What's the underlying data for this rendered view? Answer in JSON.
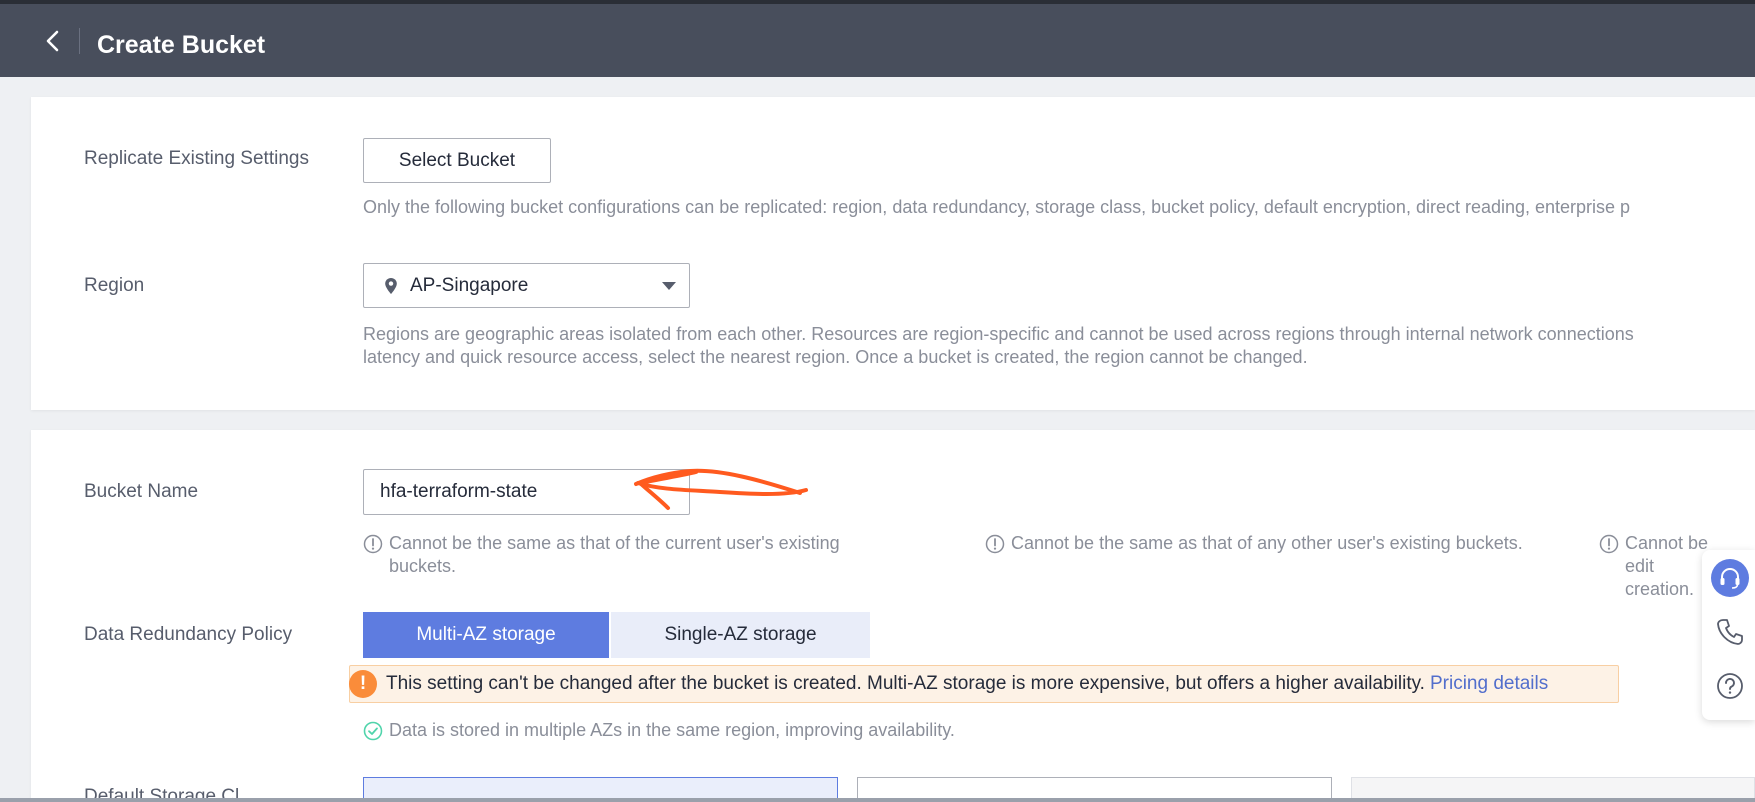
{
  "header": {
    "title": "Create Bucket",
    "back_icon": "chevron-left-icon"
  },
  "replicate": {
    "label": "Replicate Existing Settings",
    "button_label": "Select Bucket",
    "hint": "Only the following bucket configurations can be replicated: region, data redundancy, storage class, bucket policy, default encryption, direct reading, enterprise p"
  },
  "region": {
    "label": "Region",
    "value": "AP-Singapore",
    "icon": "location-pin-icon",
    "hint_line1": "Regions are geographic areas isolated from each other. Resources are region-specific and cannot be used across regions through internal network connections",
    "hint_line2": "latency and quick resource access, select the nearest region. Once a bucket is created, the region cannot be changed."
  },
  "bucket_name": {
    "label": "Bucket Name",
    "value": "hfa-terraform-state",
    "rules": [
      "Cannot be the same as that of the current user's existing buckets.",
      "Cannot be the same as that of any other user's existing buckets.",
      "Cannot be edit creation."
    ]
  },
  "redundancy": {
    "label": "Data Redundancy Policy",
    "options": [
      "Multi-AZ storage",
      "Single-AZ storage"
    ],
    "selected": "Multi-AZ storage",
    "warning": "This setting can't be changed after the bucket is created. Multi-AZ storage is more expensive, but offers a higher availability.",
    "warning_link": "Pricing details",
    "info": "Data is stored in multiple AZs in the same region, improving availability."
  },
  "storage_class": {
    "label": "Default Storage Cl"
  },
  "side_panel": {
    "items": [
      "headset-icon",
      "phone-icon",
      "help-icon"
    ]
  },
  "colors": {
    "header_bg": "#484e5c",
    "accent": "#5e7ce0",
    "warning": "#fa8c3a",
    "success": "#50d4ab",
    "annotation_arrow": "#ff5a1f"
  }
}
